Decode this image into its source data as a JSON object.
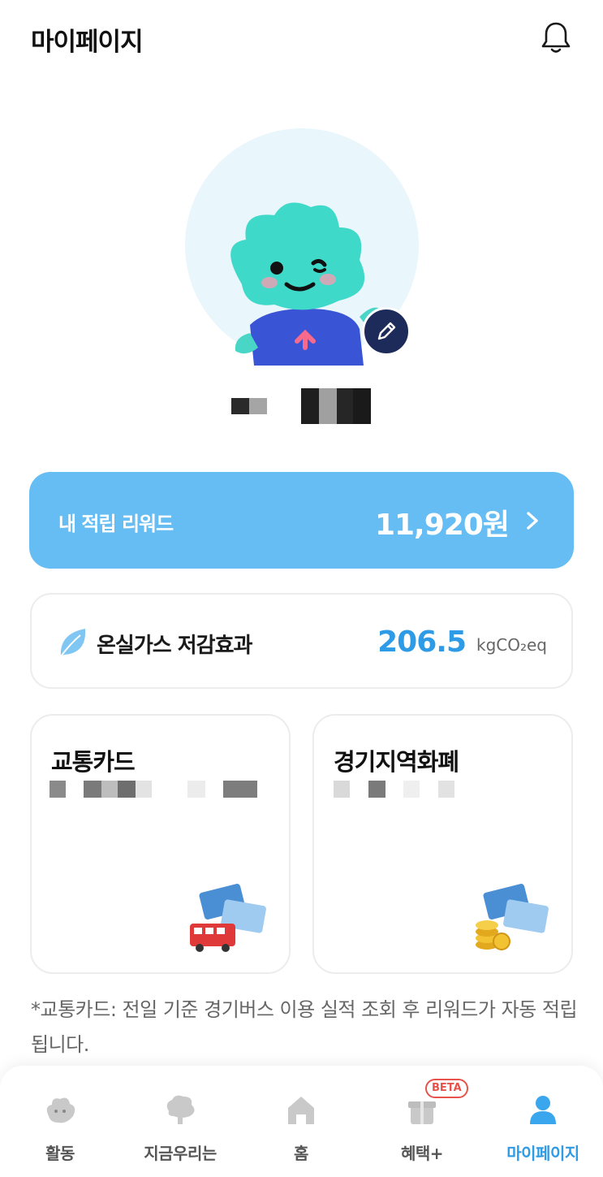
{
  "header": {
    "title": "마이페이지",
    "notification_icon": "bell-icon"
  },
  "profile": {
    "avatar_icon": "mascot-character",
    "edit_icon": "pencil-icon"
  },
  "reward": {
    "label": "내 적립 리워드",
    "amount": "11,920원",
    "chevron_icon": "chevron-right-icon",
    "color": "#66bdf3"
  },
  "ghg": {
    "label": "온실가스 저감효과",
    "value": "206.5",
    "unit": "kgCO₂eq",
    "icon": "leaf-icon",
    "value_color": "#2e9be6"
  },
  "cards": {
    "transport": {
      "title": "교통카드",
      "art_icon": "bus-card-icon"
    },
    "local_currency": {
      "title": "경기지역화폐",
      "art_icon": "coin-card-icon"
    }
  },
  "notice": {
    "text": "*교통카드: 전일 기준 경기버스 이용 실적 조회 후 리워드가 자동 적립됩니다."
  },
  "tabbar": {
    "items": [
      {
        "label": "활동",
        "icon": "activity-icon"
      },
      {
        "label": "지금우리는",
        "icon": "tree-icon"
      },
      {
        "label": "홈",
        "icon": "home-icon"
      },
      {
        "label": "혜택+",
        "icon": "gift-icon",
        "badge": "BETA"
      },
      {
        "label": "마이페이지",
        "icon": "person-icon",
        "active": true
      }
    ],
    "active_color": "#2e9be6"
  }
}
